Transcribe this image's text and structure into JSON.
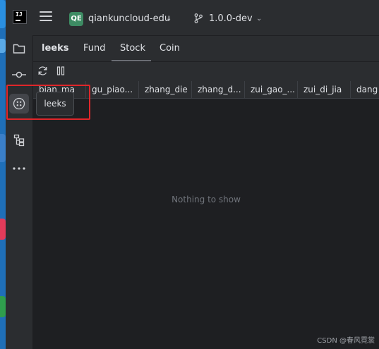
{
  "titlebar": {
    "app_logo_text": "IJ",
    "project_badge": "QE",
    "project_name": "qiankuncloud-edu",
    "branch_name": "1.0.0-dev",
    "caret_icon": "chevron-down-icon"
  },
  "toolstrip": {
    "items": [
      {
        "name": "project-folder-icon"
      },
      {
        "name": "commit-icon"
      },
      {
        "name": "leeks-plugin-icon",
        "active": true
      },
      {
        "name": "structure-icon"
      },
      {
        "name": "more-icon"
      }
    ],
    "tooltip": "leeks"
  },
  "panel": {
    "title": "leeks",
    "tabs": [
      "Fund",
      "Stock",
      "Coin"
    ],
    "selected_tab": "Stock",
    "toolbar": {
      "refresh_icon": "refresh-icon",
      "pause_icon": "pause-icon"
    },
    "columns": [
      "bian_ma",
      "gu_piao...",
      "zhang_die",
      "zhang_d...",
      "zui_gao_...",
      "zui_di_jia",
      "dang"
    ],
    "empty_text": "Nothing to show"
  },
  "watermark": "CSDN @春风霓裳",
  "colors": {
    "highlight": "#e0262a",
    "badge": "#3d8b63",
    "background": "#2b2d30"
  }
}
